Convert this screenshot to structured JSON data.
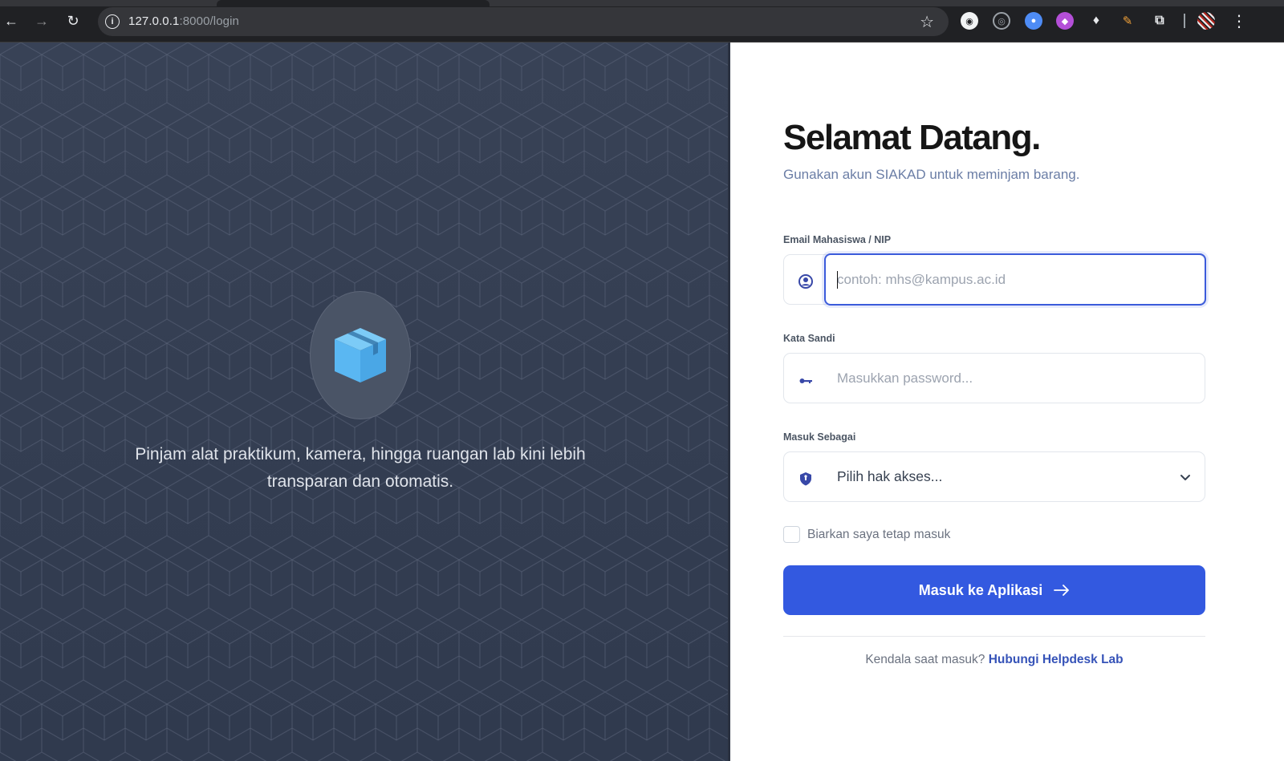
{
  "browser": {
    "url_host": "127.0.0.1",
    "url_path": ":8000/login"
  },
  "hero": {
    "tagline": "Pinjam alat praktikum, kamera, hingga ruangan lab kini lebih transparan dan otomatis.",
    "logo_icon": "box-icon"
  },
  "login": {
    "title": "Selamat Datang.",
    "subtitle": "Gunakan akun SIAKAD untuk meminjam barang.",
    "email": {
      "label": "Email Mahasiswa / NIP",
      "placeholder": "contoh: mhs@kampus.ac.id",
      "icon": "user-circle-icon"
    },
    "password": {
      "label": "Kata Sandi",
      "placeholder": "Masukkan password...",
      "icon": "key-icon"
    },
    "role": {
      "label": "Masuk Sebagai",
      "selected": "Pilih hak akses...",
      "icon": "shield-icon"
    },
    "remember_label": "Biarkan saya tetap masuk",
    "submit_label": "Masuk ke Aplikasi",
    "help_text": "Kendala saat masuk?",
    "help_link": "Hubungi Helpdesk Lab"
  },
  "colors": {
    "primary": "#3359e0",
    "panel_dark": "#343e52",
    "link": "#3653b8",
    "icon_blue": "#5ab7f2"
  }
}
